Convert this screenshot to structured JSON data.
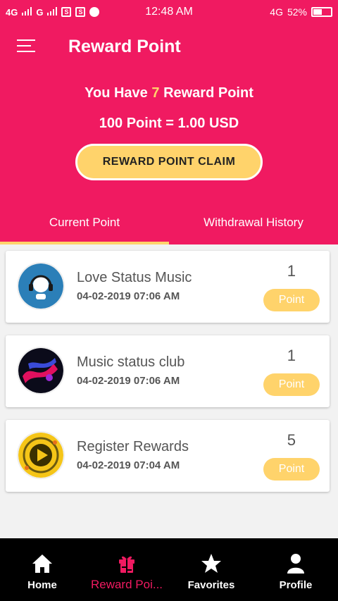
{
  "status_bar": {
    "signal_1": "4G",
    "signal_2": "G",
    "time": "12:48 AM",
    "network": "4G",
    "battery": "52%",
    "battery_level": 0.52
  },
  "header": {
    "title": "Reward Point",
    "reward_prefix": "You Have",
    "reward_count": "7",
    "reward_suffix": "Reward Point",
    "rate": "100 Point = 1.00 USD",
    "claim_label": "REWARD POINT CLAIM"
  },
  "tabs": [
    {
      "label": "Current Point",
      "active": true
    },
    {
      "label": "Withdrawal History",
      "active": false
    }
  ],
  "items": [
    {
      "name": "Love Status Music",
      "date": "04-02-2019 07:06 AM",
      "points": "1",
      "badge": "Point",
      "icon": "headphones-avatar"
    },
    {
      "name": "Music status club",
      "date": "04-02-2019 07:06 AM",
      "points": "1",
      "badge": "Point",
      "icon": "music-club-avatar"
    },
    {
      "name": "Register Rewards",
      "date": "04-02-2019 07:04 AM",
      "points": "5",
      "badge": "Point",
      "icon": "play-reward-avatar"
    }
  ],
  "bottom_nav": [
    {
      "label": "Home",
      "icon": "home-icon",
      "active": false
    },
    {
      "label": "Reward Poi...",
      "icon": "reward-icon",
      "active": true
    },
    {
      "label": "Favorites",
      "icon": "star-icon",
      "active": false
    },
    {
      "label": "Profile",
      "icon": "person-icon",
      "active": false
    }
  ],
  "colors": {
    "primary": "#f01a61",
    "accent": "#ffd36b",
    "nav_bg": "#000000"
  }
}
